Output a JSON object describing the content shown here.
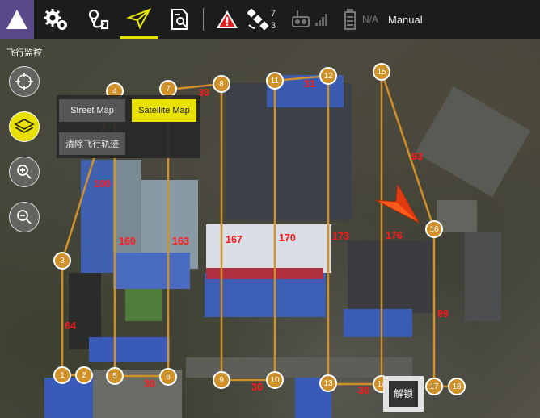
{
  "topbar": {
    "satellite_count": "7",
    "satellite_lock": "3",
    "battery_text": "N/A",
    "flight_mode": "Manual"
  },
  "side_title": "飞行监控",
  "map_type": {
    "street_label": "Street Map",
    "satellite_label": "Satellite Map",
    "selected": "Satellite Map",
    "clear_track_label": "清除飞行轨迹"
  },
  "unlock_label": "解锁",
  "colors": {
    "accent": "#ffe000",
    "waypoint": "#d0902a",
    "path": "#d0902a",
    "distance": "#ff1a1a",
    "logo_bg": "#5a4a8c"
  },
  "waypoints": [
    "1",
    "2",
    "3",
    "4",
    "5",
    "6",
    "7",
    "8",
    "9",
    "10",
    "11",
    "12",
    "13",
    "14",
    "15",
    "16",
    "17",
    "18"
  ],
  "distances": [
    "64",
    "100",
    "160",
    "163",
    "167",
    "170",
    "173",
    "176",
    "30",
    "30",
    "31",
    "30",
    "30",
    "93",
    "89"
  ]
}
